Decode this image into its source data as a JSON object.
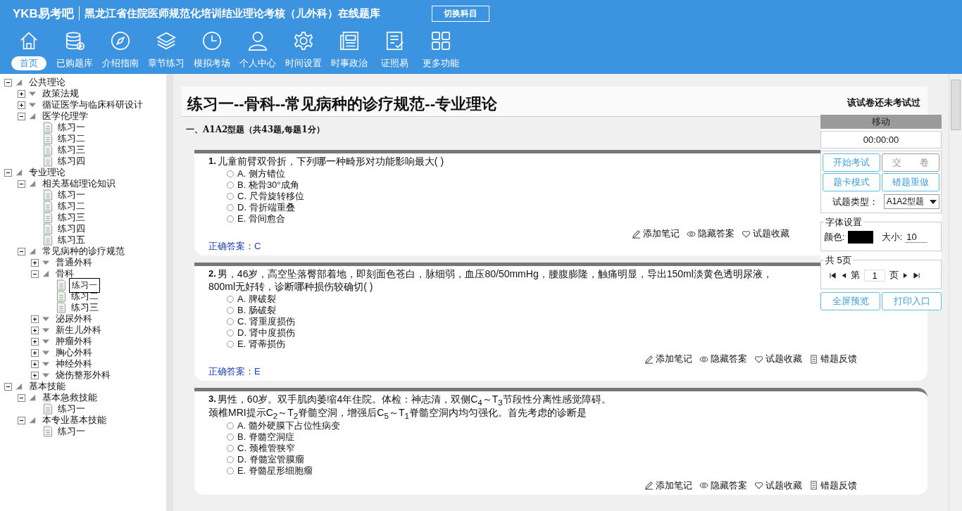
{
  "header": {
    "logo": "YKB易考吧",
    "title": "黑龙江省住院医师规范化培训结业理论考核（儿外科）在线题库",
    "switch_button": "切换科目"
  },
  "toolbar": [
    {
      "label": "首页",
      "kind": "home",
      "selected": true
    },
    {
      "label": "已购题库",
      "kind": "database",
      "selected": false
    },
    {
      "label": "介绍指南",
      "kind": "compass",
      "selected": false
    },
    {
      "label": "章节练习",
      "kind": "layers",
      "selected": false
    },
    {
      "label": "模拟考场",
      "kind": "clock",
      "selected": false
    },
    {
      "label": "个人中心",
      "kind": "person",
      "selected": false
    },
    {
      "label": "时间设置",
      "kind": "gear",
      "selected": false
    },
    {
      "label": "时事政治",
      "kind": "news",
      "selected": false
    },
    {
      "label": "证照易",
      "kind": "checklist",
      "selected": false
    },
    {
      "label": "更多功能",
      "kind": "grid",
      "selected": false
    }
  ],
  "tree": [
    {
      "label": "公共理论",
      "expanded": true,
      "children": [
        {
          "label": "政策法规",
          "expanded": false
        },
        {
          "label": "循证医学与临床科研设计",
          "expanded": false
        },
        {
          "label": "医学伦理学",
          "expanded": true,
          "children": [
            {
              "label": "练习一",
              "selected": false
            },
            {
              "label": "练习二",
              "selected": false
            },
            {
              "label": "练习三",
              "selected": false
            },
            {
              "label": "练习四",
              "selected": false
            }
          ]
        }
      ]
    },
    {
      "label": "专业理论",
      "expanded": true,
      "children": [
        {
          "label": "相关基础理论知识",
          "expanded": true,
          "children": [
            {
              "label": "练习一",
              "selected": false
            },
            {
              "label": "练习二",
              "selected": false
            },
            {
              "label": "练习三",
              "selected": false
            },
            {
              "label": "练习四",
              "selected": false
            },
            {
              "label": "练习五",
              "selected": false
            }
          ]
        },
        {
          "label": "常见病种的诊疗规范",
          "expanded": true,
          "children": [
            {
              "label": "普通外科",
              "expanded": false
            },
            {
              "label": "骨科",
              "expanded": true,
              "children": [
                {
                  "label": "练习一",
                  "selected": true
                },
                {
                  "label": "练习二",
                  "selected": false
                },
                {
                  "label": "练习三",
                  "selected": false
                }
              ]
            },
            {
              "label": "泌尿外科",
              "expanded": false
            },
            {
              "label": "新生儿外科",
              "expanded": false
            },
            {
              "label": "肿瘤外科",
              "expanded": false
            },
            {
              "label": "胸心外科",
              "expanded": false
            },
            {
              "label": "神经外科",
              "expanded": false
            },
            {
              "label": "烧伤整形外科",
              "expanded": false
            }
          ]
        }
      ]
    },
    {
      "label": "基本技能",
      "expanded": true,
      "children": [
        {
          "label": "基本急救技能",
          "expanded": true,
          "children": [
            {
              "label": "练习一",
              "selected": false
            }
          ]
        },
        {
          "label": "本专业基本技能",
          "expanded": true,
          "children": [
            {
              "label": "练习一",
              "selected": false
            }
          ]
        }
      ]
    }
  ],
  "exam": {
    "title": "练习一--骨科--常见病种的诊疗规范--专业理论",
    "status": "该试卷还未考试过",
    "section": "一、A1A2型题（共43题,每题1分）",
    "questions": [
      {
        "number": "1.",
        "lines": [
          "儿童前臂双骨折，下列哪一种畸形对功能影响最大( )"
        ],
        "options": [
          {
            "text": "A. 侧方错位",
            "checked": false
          },
          {
            "text": "B. 桡骨30°成角",
            "checked": false
          },
          {
            "text": "C. 尺骨旋转移位",
            "checked": false
          },
          {
            "text": "D. 骨折端重叠",
            "checked": false
          },
          {
            "text": "E. 骨间愈合",
            "checked": false
          }
        ],
        "actions": [
          "添加笔记",
          "隐藏答案",
          "试题收藏"
        ],
        "answer": "正确答案：C"
      },
      {
        "number": "2.",
        "lines": [
          "男，46岁，高空坠落臀部着地，即刻面色苍白，脉细弱，血压80/50mmHg，腰腹膨隆，触痛明显，导出150ml淡黄色透明尿液，",
          "800ml无好转，诊断哪种损伤较确切( )"
        ],
        "options": [
          {
            "text": "A. 脾破裂",
            "checked": false
          },
          {
            "text": "B. 肠破裂",
            "checked": false
          },
          {
            "text": "C. 肾重度损伤",
            "checked": false
          },
          {
            "text": "D. 肾中度损伤",
            "checked": false
          },
          {
            "text": "E. 肾蒂损伤",
            "checked": false
          }
        ],
        "actions": [
          "添加笔记",
          "隐藏答案",
          "试题收藏",
          "错题反馈"
        ],
        "answer": "正确答案：E"
      },
      {
        "number": "3.",
        "lines": [
          "男性，60岁。双手肌肉萎缩4年住院。体检：神志清，双侧C$_{4}$～T$_{3}$节段性分离性感觉障碍。",
          "颈椎MRI提示C$_{2}$～T$_{2}$脊髓空洞，增强后C$_{5}$～T$_{1}$脊髓空洞内均匀强化。首先考虑的诊断是"
        ],
        "options": [
          {
            "text": "A. 髓外硬膜下占位性病变",
            "checked": false
          },
          {
            "text": "B. 脊髓空洞症",
            "checked": false
          },
          {
            "text": "C. 颈椎管狭窄",
            "checked": false
          },
          {
            "text": "D. 脊髓室管膜瘤",
            "checked": false
          },
          {
            "text": "E. 脊髓星形细胞瘤",
            "checked": false
          }
        ],
        "actions": [
          "添加笔记",
          "隐藏答案",
          "试题收藏",
          "错题反馈"
        ]
      }
    ]
  },
  "panel": {
    "header": "移动",
    "timer": "00:00:00",
    "buttons": [
      "开始考试",
      "交　　卷",
      "题卡模式",
      "错题重做"
    ],
    "type_label": "试题类型：",
    "type_value": "A1A2型题",
    "font_legend": "字体设置",
    "color_label": "颜色:",
    "color": "#000000",
    "size_label": "大小:",
    "size_value": "10",
    "pages_legend": "共 5页",
    "page_prefix": "第",
    "page_value": "1",
    "page_suffix": "页",
    "bottom_buttons": [
      "全屏预览",
      "打印入口"
    ]
  }
}
